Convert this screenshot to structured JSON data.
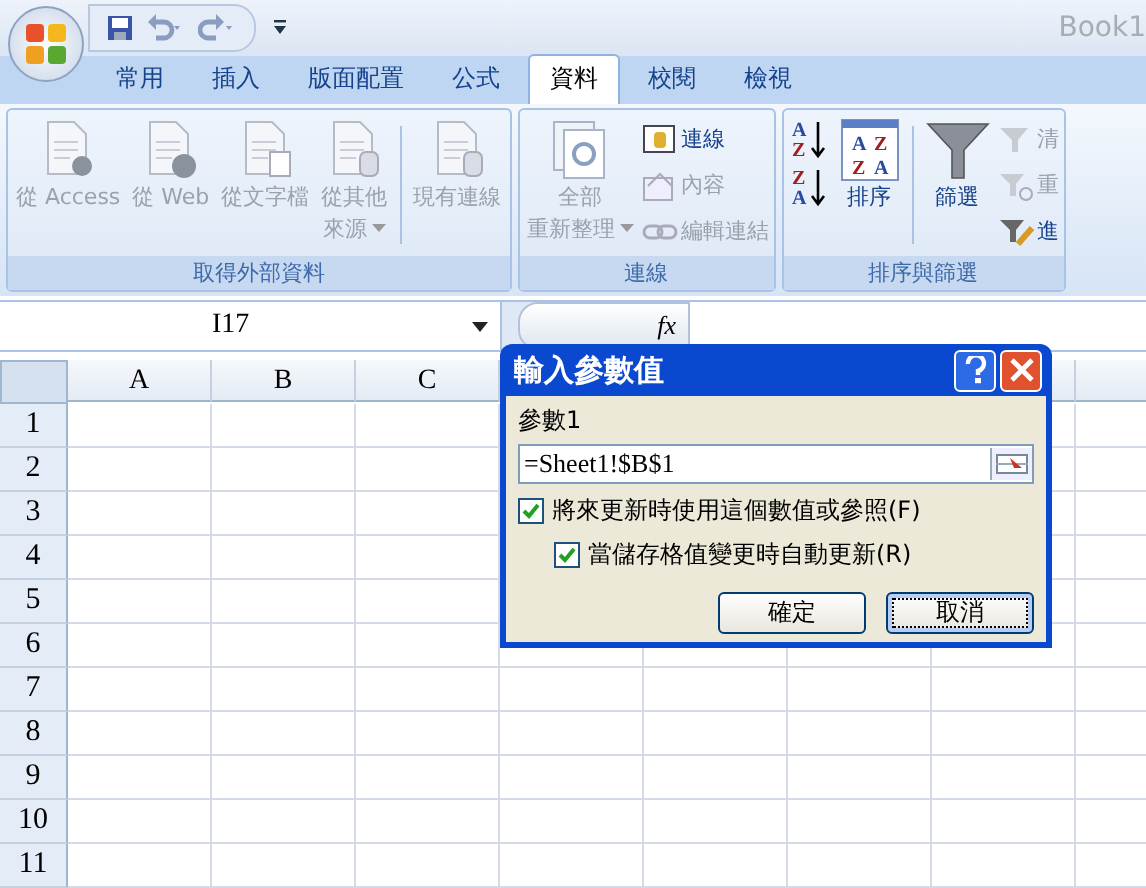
{
  "window": {
    "title": "Book1"
  },
  "tabs": [
    {
      "label": "常用",
      "selected": false
    },
    {
      "label": "插入",
      "selected": false
    },
    {
      "label": "版面配置",
      "selected": false
    },
    {
      "label": "公式",
      "selected": false
    },
    {
      "label": "資料",
      "selected": true
    },
    {
      "label": "校閱",
      "selected": false
    },
    {
      "label": "檢視",
      "selected": false
    }
  ],
  "ribbon": [
    {
      "title": "取得外部資料",
      "items": [
        {
          "kind": "large",
          "label_lines": [
            "從 Access"
          ],
          "disabled": true
        },
        {
          "kind": "large",
          "label_lines": [
            "從 Web"
          ],
          "disabled": true
        },
        {
          "kind": "large",
          "label_lines": [
            "從文字檔"
          ],
          "disabled": true
        },
        {
          "kind": "large",
          "label_lines": [
            "從其他",
            "來源"
          ],
          "dropdown": true,
          "disabled": true
        },
        {
          "kind": "separator"
        },
        {
          "kind": "large",
          "label_lines": [
            "現有連線"
          ],
          "disabled": true
        }
      ]
    },
    {
      "title": "連線",
      "items": [
        {
          "kind": "large",
          "label_lines": [
            "全部",
            "重新整理"
          ],
          "dropdown": true,
          "disabled": true
        },
        {
          "kind": "stack",
          "items": [
            {
              "label": "連線",
              "disabled": false
            },
            {
              "label": "內容",
              "disabled": true
            },
            {
              "label": "編輯連結",
              "disabled": true
            }
          ]
        }
      ]
    },
    {
      "title": "排序與篩選",
      "items": [
        {
          "kind": "sortpair",
          "items": [
            {
              "glyphs": [
                "A",
                "Z"
              ]
            },
            {
              "glyphs": [
                "Z",
                "A"
              ]
            }
          ]
        },
        {
          "kind": "large",
          "glyphs": [
            "A",
            "Z",
            "Z",
            "A"
          ],
          "label_lines": [
            "排序"
          ],
          "disabled": false
        },
        {
          "kind": "separator"
        },
        {
          "kind": "large",
          "label_lines": [
            "篩選"
          ],
          "disabled": false
        },
        {
          "kind": "stack",
          "items": [
            {
              "label": "清",
              "disabled": true
            },
            {
              "label": "重",
              "disabled": true
            },
            {
              "label": "進",
              "disabled": false
            }
          ]
        }
      ]
    }
  ],
  "name_box": {
    "value": "I17"
  },
  "formula_bar": {
    "fx": "fx"
  },
  "columns": [
    "A",
    "B",
    "C"
  ],
  "rows": [
    "1",
    "2",
    "3",
    "4",
    "5",
    "6",
    "7",
    "8",
    "9",
    "10",
    "11"
  ],
  "dialog": {
    "title": "輸入參數值",
    "field_label": "參數1",
    "field_value": "=Sheet1!$B$1",
    "options": [
      {
        "label": "將來更新時使用這個數值或參照(F)",
        "checked": true,
        "children": [
          {
            "label": "當儲存格值變更時自動更新(R)",
            "checked": true
          }
        ]
      }
    ],
    "buttons": [
      {
        "label": "確定",
        "selected": false
      },
      {
        "label": "取消",
        "selected": true
      }
    ]
  }
}
